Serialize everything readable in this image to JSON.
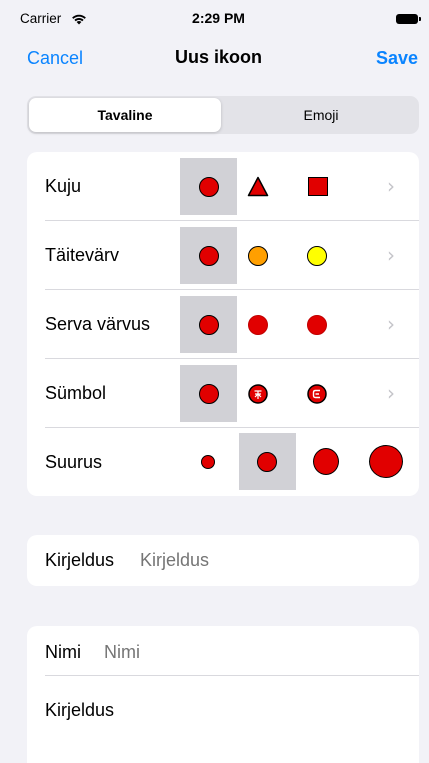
{
  "status": {
    "carrier": "Carrier",
    "time": "2:29 PM"
  },
  "nav": {
    "cancel": "Cancel",
    "title": "Uus ikoon",
    "save": "Save"
  },
  "segmented": {
    "options": [
      "Tavaline",
      "Emoji"
    ],
    "selected": "Tavaline"
  },
  "icon_options": {
    "rows": [
      {
        "label": "Kuju",
        "selected_index": 0,
        "options": [
          "circle",
          "triangle",
          "square"
        ]
      },
      {
        "label": "Täitevärv",
        "selected_index": 0,
        "options": [
          "red",
          "orange",
          "yellow"
        ]
      },
      {
        "label": "Serva värvus",
        "selected_index": 0,
        "options": [
          "black",
          "red",
          "red"
        ]
      },
      {
        "label": "Sümbol",
        "selected_index": 0,
        "options": [
          "none",
          "symbol-a",
          "symbol-b"
        ]
      },
      {
        "label": "Suurus",
        "selected_index": 1,
        "options": [
          "small",
          "medium",
          "large",
          "extra-large"
        ]
      }
    ],
    "colors": {
      "red": "#e10000",
      "orange": "#ff9f00",
      "yellow": "#ffff00",
      "selection": "#d1d1d6"
    }
  },
  "description_field": {
    "label": "Kirjeldus",
    "placeholder": "Kirjeldus"
  },
  "name_section": {
    "name_label": "Nimi",
    "name_placeholder": "Nimi",
    "description_label": "Kirjeldus"
  },
  "theme": {
    "accent": "#0a84ff",
    "background": "#f2f2f7"
  }
}
